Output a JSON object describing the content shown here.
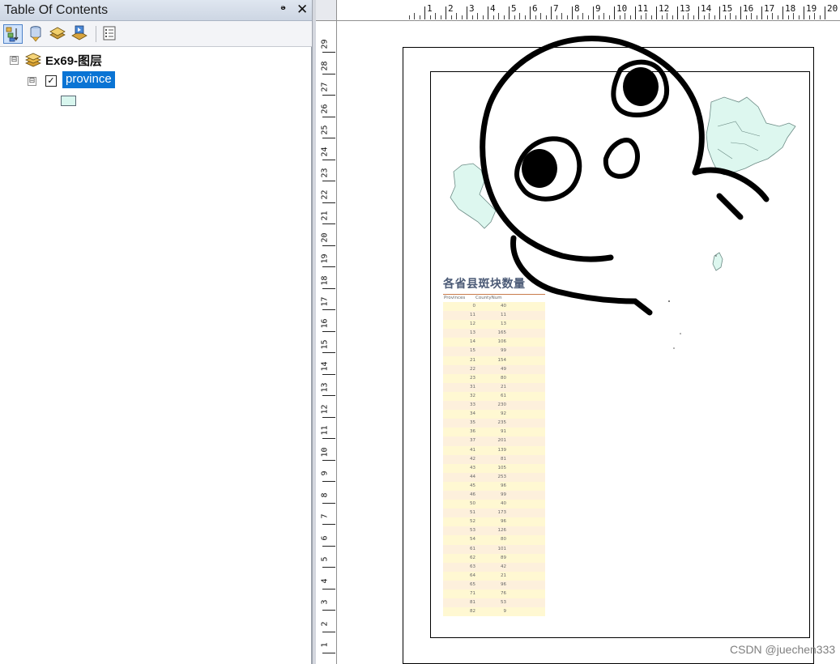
{
  "toc": {
    "title": "Table Of Contents",
    "pin_glyph": "ᵖ",
    "close_glyph": "✕",
    "toolbar": [
      {
        "name": "list-by-drawing-order-icon",
        "active": true
      },
      {
        "name": "list-by-source-icon",
        "active": false
      },
      {
        "name": "list-by-visibility-icon",
        "active": false
      },
      {
        "name": "list-by-selection-icon",
        "active": false
      },
      {
        "name": "options-icon",
        "active": false
      }
    ],
    "data_frame": {
      "label": "Ex69-图层",
      "expander": "⊟"
    },
    "layer": {
      "label": "province",
      "checked": true,
      "check_glyph": "✓",
      "expander": "⊟",
      "symbol_color": "#d8f6ee"
    }
  },
  "rulers": {
    "horizontal_ticks": [
      "1",
      "2",
      "3",
      "4",
      "5",
      "6",
      "7",
      "8",
      "9",
      "10",
      "11",
      "12",
      "13",
      "14",
      "15",
      "16",
      "17",
      "18",
      "19",
      "20"
    ],
    "vertical_ticks": [
      "29",
      "28",
      "27",
      "26",
      "25",
      "24",
      "23",
      "22",
      "21",
      "20",
      "19",
      "18",
      "17",
      "16",
      "15",
      "14",
      "13",
      "12",
      "11",
      "10",
      "9",
      "8",
      "7",
      "6",
      "5",
      "4",
      "3",
      "2",
      "1"
    ]
  },
  "map": {
    "fill_color": "#ddf7ef",
    "outline_color": "#6a8a84"
  },
  "table": {
    "title": "各省县斑块数量",
    "header": [
      "Provinces",
      "CountyNum"
    ],
    "rows": [
      [
        "0",
        "40"
      ],
      [
        "11",
        "11"
      ],
      [
        "12",
        "13"
      ],
      [
        "13",
        "165"
      ],
      [
        "14",
        "106"
      ],
      [
        "15",
        "99"
      ],
      [
        "21",
        "154"
      ],
      [
        "22",
        "49"
      ],
      [
        "23",
        "80"
      ],
      [
        "31",
        "21"
      ],
      [
        "32",
        "61"
      ],
      [
        "33",
        "230"
      ],
      [
        "34",
        "92"
      ],
      [
        "35",
        "235"
      ],
      [
        "36",
        "91"
      ],
      [
        "37",
        "201"
      ],
      [
        "41",
        "139"
      ],
      [
        "42",
        "81"
      ],
      [
        "43",
        "105"
      ],
      [
        "44",
        "253"
      ],
      [
        "45",
        "96"
      ],
      [
        "46",
        "99"
      ],
      [
        "50",
        "40"
      ],
      [
        "51",
        "173"
      ],
      [
        "52",
        "96"
      ],
      [
        "53",
        "126"
      ],
      [
        "54",
        "80"
      ],
      [
        "61",
        "101"
      ],
      [
        "62",
        "89"
      ],
      [
        "63",
        "42"
      ],
      [
        "64",
        "21"
      ],
      [
        "65",
        "96"
      ],
      [
        "71",
        "76"
      ],
      [
        "81",
        "53"
      ],
      [
        "82",
        "9"
      ]
    ]
  },
  "watermark": "CSDN @juechen333"
}
